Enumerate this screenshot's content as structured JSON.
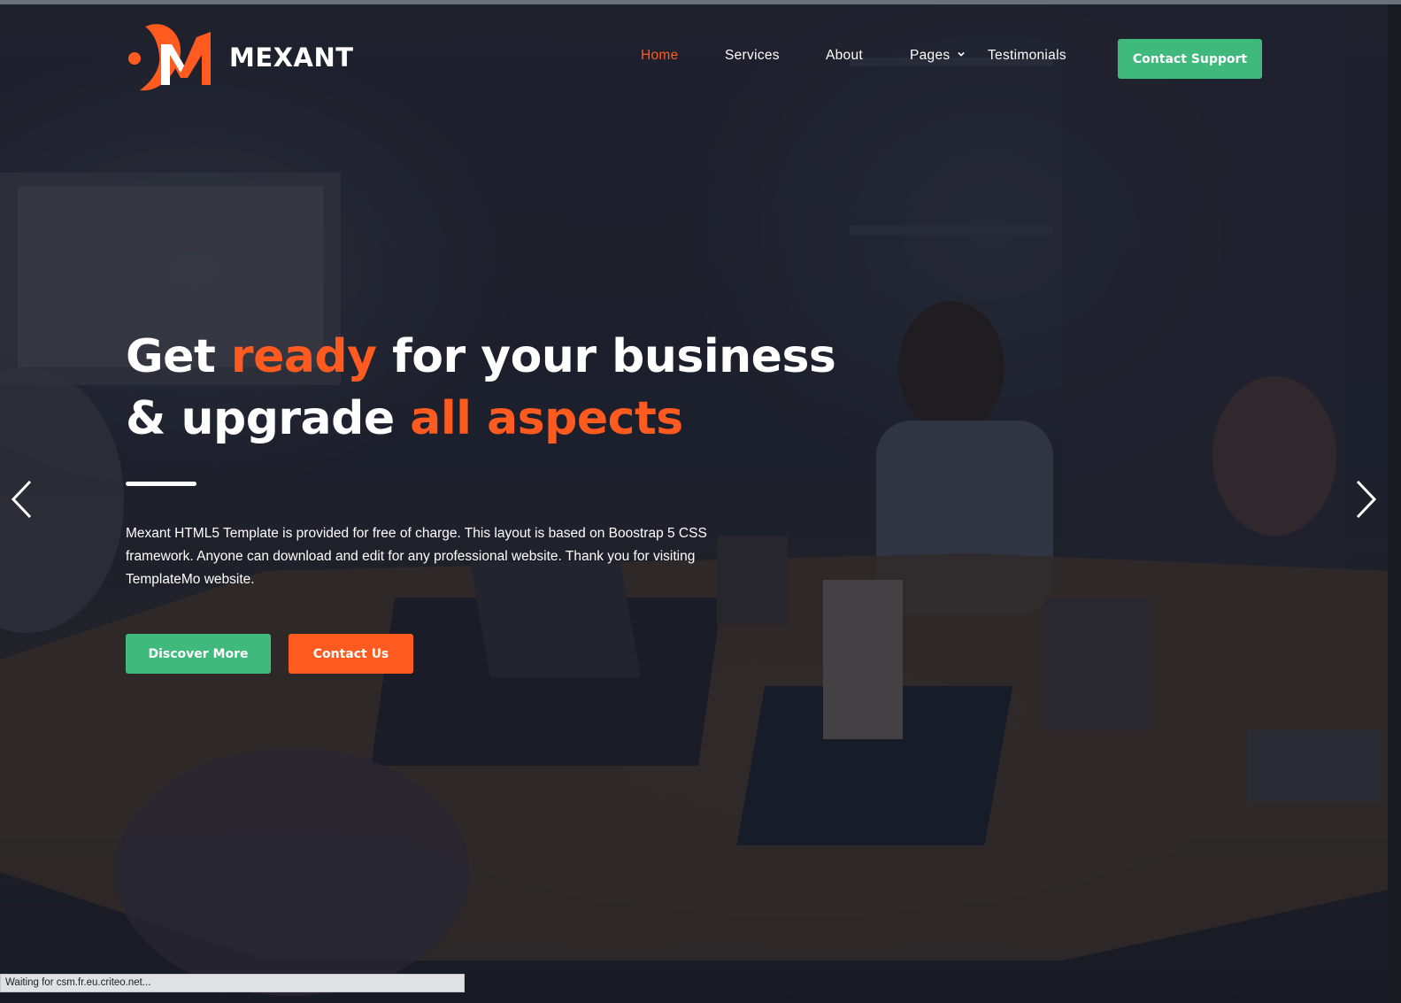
{
  "brand": {
    "name": "MEXANT",
    "accent": "#ff5a1f",
    "green": "#3fb97c"
  },
  "nav": {
    "items": [
      {
        "label": "Home",
        "active": true
      },
      {
        "label": "Services"
      },
      {
        "label": "About"
      },
      {
        "label": "Pages",
        "dropdown": true
      },
      {
        "label": "Testimonials"
      }
    ],
    "cta_label": "Contact Support"
  },
  "hero": {
    "headline": {
      "line1_a": "Get ",
      "line1_hl": "ready",
      "line1_b": " for your business",
      "line2_a": "& upgrade ",
      "line2_hl": "all aspects"
    },
    "description": "Mexant HTML5 Template is provided for free of charge. This layout is based on Boostrap 5 CSS framework. Anyone can download and edit for any professional website. Thank you for visiting TemplateMo website.",
    "primary_button": "Discover More",
    "secondary_button": "Contact Us",
    "carousel": {
      "prev_icon": "chevron-left-icon",
      "next_icon": "chevron-right-icon"
    }
  },
  "browser": {
    "status_text": "Waiting for csm.fr.eu.criteo.net..."
  }
}
